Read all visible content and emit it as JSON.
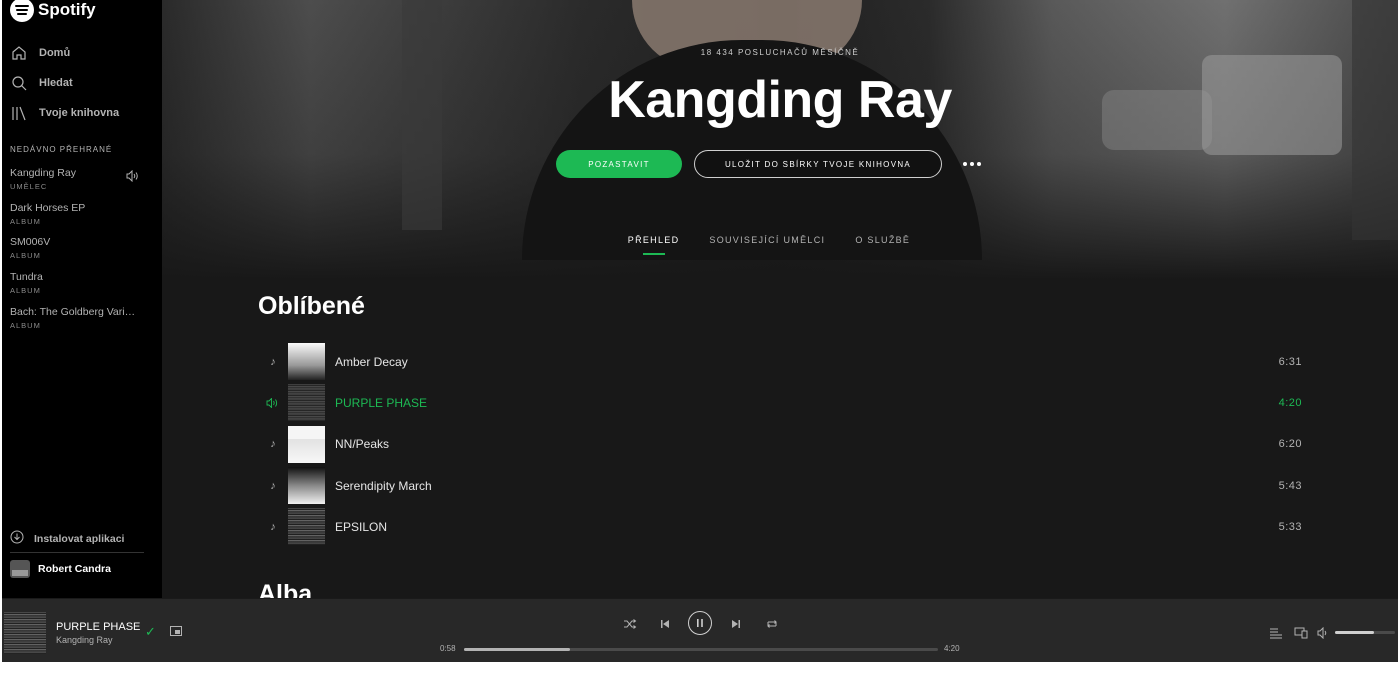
{
  "app": {
    "name": "Spotify"
  },
  "sidebar": {
    "nav": [
      {
        "label": "Domů",
        "icon": "home-icon"
      },
      {
        "label": "Hledat",
        "icon": "search-icon"
      },
      {
        "label": "Tvoje knihovna",
        "icon": "library-icon"
      }
    ],
    "recent_title": "NEDÁVNO PŘEHRANÉ",
    "recent": [
      {
        "title": "Kangding Ray",
        "subtitle": "UMĚLEC"
      },
      {
        "title": "Dark Horses EP",
        "subtitle": "ALBUM"
      },
      {
        "title": "SM006V",
        "subtitle": "ALBUM"
      },
      {
        "title": "Tundra",
        "subtitle": "ALBUM"
      },
      {
        "title": "Bach: The Goldberg Variations",
        "subtitle": "ALBUM"
      }
    ],
    "install_label": "Instalovat aplikaci",
    "user_name": "Robert Candra"
  },
  "artist": {
    "listeners": "18 434 POSLUCHAČŮ MĚSÍČNĚ",
    "name": "Kangding Ray",
    "pause_label": "POZASTAVIT",
    "save_label": "ULOŽIT DO SBÍRKY TVOJE KNIHOVNA"
  },
  "tabs": [
    {
      "label": "PŘEHLED",
      "active": true
    },
    {
      "label": "SOUVISEJÍCÍ UMĚLCI",
      "active": false
    },
    {
      "label": "O SLUŽBĚ",
      "active": false
    }
  ],
  "favorites": {
    "heading": "Oblíbené",
    "tracks": [
      {
        "title": "Amber Decay",
        "duration": "6:31",
        "playing": false
      },
      {
        "title": "PURPLE PHASE",
        "duration": "4:20",
        "playing": true
      },
      {
        "title": "NN/Peaks",
        "duration": "6:20",
        "playing": false
      },
      {
        "title": "Serendipity March",
        "duration": "5:43",
        "playing": false
      },
      {
        "title": "EPSILON",
        "duration": "5:33",
        "playing": false
      }
    ]
  },
  "albums_heading": "Alba",
  "player": {
    "title": "PURPLE PHASE",
    "artist": "Kangding Ray",
    "elapsed": "0:58",
    "total": "4:20",
    "progress": 0.223,
    "volume": 0.65,
    "accent": "#1db954"
  }
}
